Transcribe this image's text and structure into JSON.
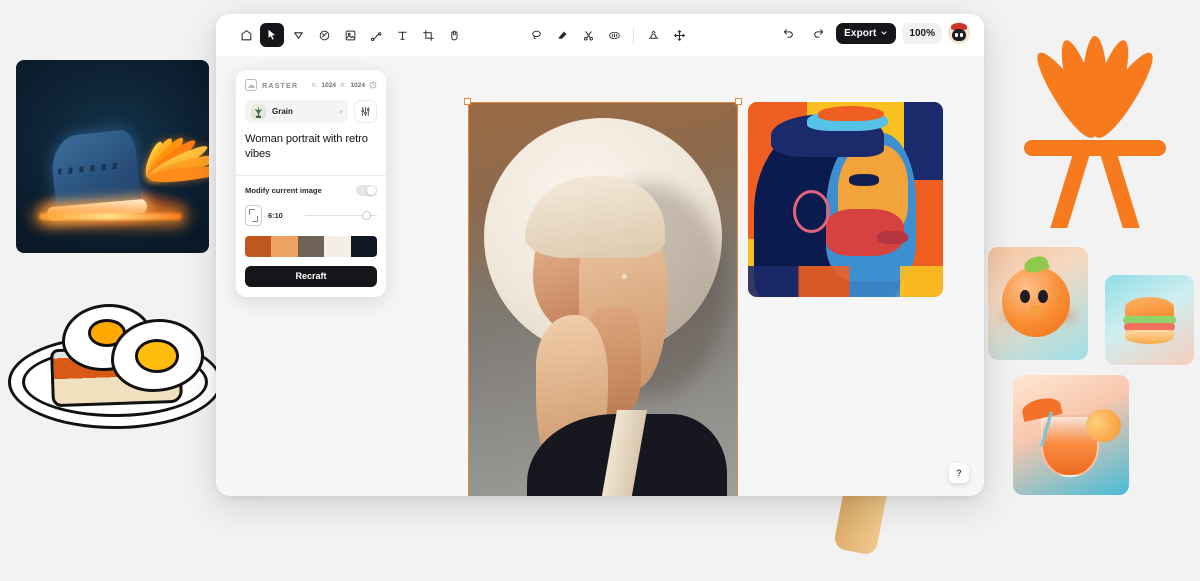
{
  "toolbar": {
    "left_tools": [
      {
        "name": "home-icon",
        "label": "Home"
      },
      {
        "name": "select-tool-icon",
        "label": "Select"
      },
      {
        "name": "cursor-tool-icon",
        "label": "Cursor"
      },
      {
        "name": "image-generate-icon",
        "label": "Generate image"
      },
      {
        "name": "frame-image-icon",
        "label": "Image frame"
      },
      {
        "name": "vector-pen-icon",
        "label": "Vector"
      },
      {
        "name": "text-tool-icon",
        "label": "Text"
      },
      {
        "name": "crop-tool-icon",
        "label": "Crop"
      },
      {
        "name": "hand-tool-icon",
        "label": "Hand"
      }
    ],
    "center_tools": [
      {
        "name": "lasso-tool-icon",
        "label": "Lasso"
      },
      {
        "name": "eraser-tool-icon",
        "label": "Eraser"
      },
      {
        "name": "scissors-tool-icon",
        "label": "Cut"
      },
      {
        "name": "inpaint-tool-icon",
        "label": "Inpaint"
      },
      {
        "name": "expand-tool-icon",
        "label": "Expand"
      },
      {
        "name": "move-tool-icon",
        "label": "Move"
      }
    ],
    "undo_label": "Undo",
    "redo_label": "Redo",
    "export_label": "Export",
    "zoom_level": "100%",
    "avatar_label": "Account"
  },
  "panel": {
    "type_label": "RASTER",
    "width_key": "X:",
    "width_value": "1024",
    "height_key": "X:",
    "height_value": "1024",
    "history_icon": "clock-icon",
    "style_name": "Grain",
    "style_chevron": "›",
    "settings_icon": "sliders-icon",
    "prompt_text": "Woman portrait with retro vibes",
    "modify_label": "Modify current image",
    "modify_enabled": false,
    "ratio_value": "6:10",
    "palette": [
      "#c0571f",
      "#eda364",
      "#6e6257",
      "#f4efe4",
      "#101722"
    ],
    "recraft_label": "Recraft"
  },
  "canvas": {
    "selected_artwork": "woman-portrait-retro",
    "secondary_artwork": "pop-art-male-profile",
    "help_label": "?"
  },
  "background_art": [
    {
      "name": "winged-sneaker-artwork"
    },
    {
      "name": "eggs-on-toast-artwork"
    },
    {
      "name": "retro-raygun-artwork"
    },
    {
      "name": "popsicle-artwork"
    },
    {
      "name": "brand-logo-artwork"
    },
    {
      "name": "orange-bird-thumbnail"
    },
    {
      "name": "burger-thumbnail"
    },
    {
      "name": "cocktail-thumbnail"
    }
  ],
  "colors": {
    "accent": "#f77a1c",
    "selection": "#e08a3c",
    "dark": "#16161a",
    "page_bg": "#f2f2f2"
  }
}
